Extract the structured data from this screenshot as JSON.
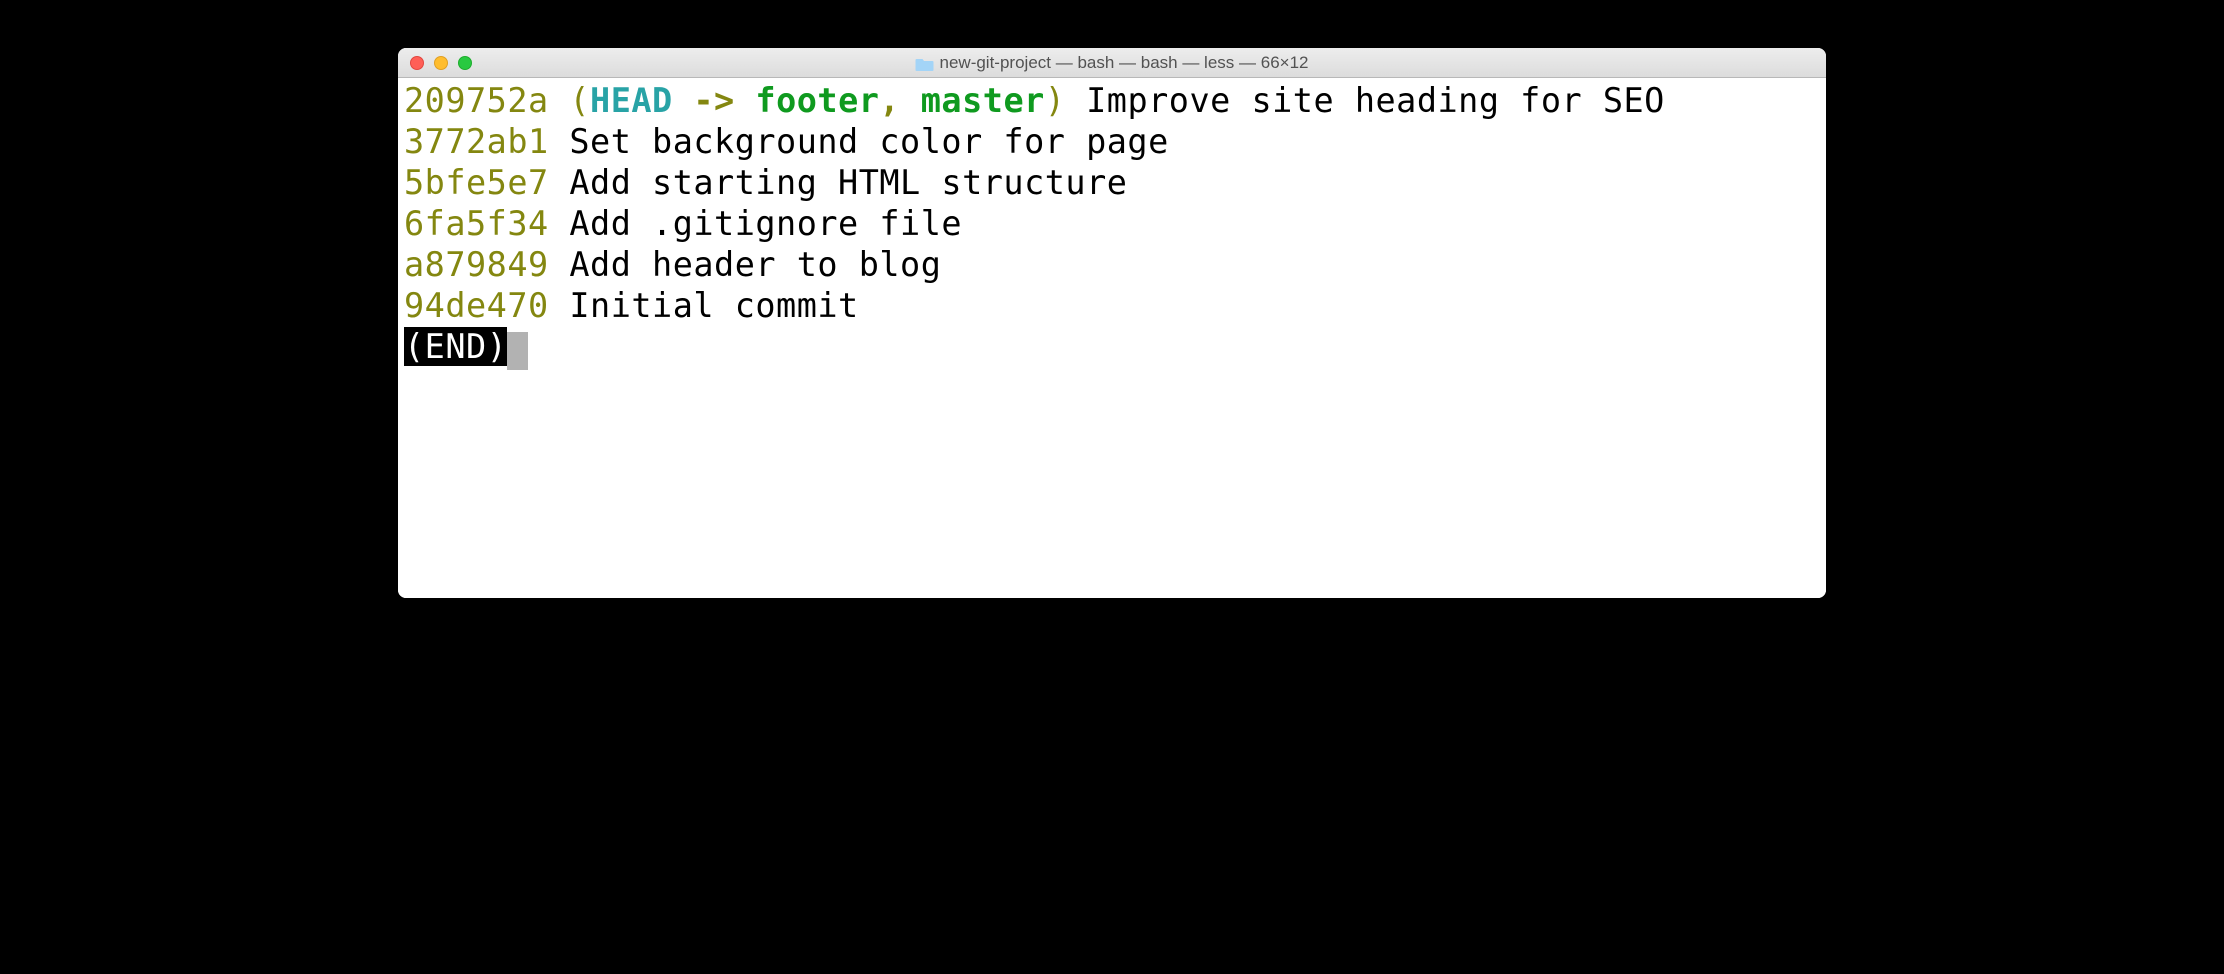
{
  "titlebar": {
    "title": "new-git-project — bash — bash — less — 66×12"
  },
  "log": [
    {
      "hash": "209752a",
      "refs": {
        "open": "(",
        "head": "HEAD",
        "arrow": " -> ",
        "branches": [
          "footer",
          "master"
        ],
        "close": ")"
      },
      "message": "Improve site heading for SEO"
    },
    {
      "hash": "3772ab1",
      "message": "Set background color for page"
    },
    {
      "hash": "5bfe5e7",
      "message": "Add starting HTML structure"
    },
    {
      "hash": "6fa5f34",
      "message": "Add .gitignore file"
    },
    {
      "hash": "a879849",
      "message": "Add header to blog"
    },
    {
      "hash": "94de470",
      "message": "Initial commit"
    }
  ],
  "pager": {
    "end": "(END)"
  }
}
